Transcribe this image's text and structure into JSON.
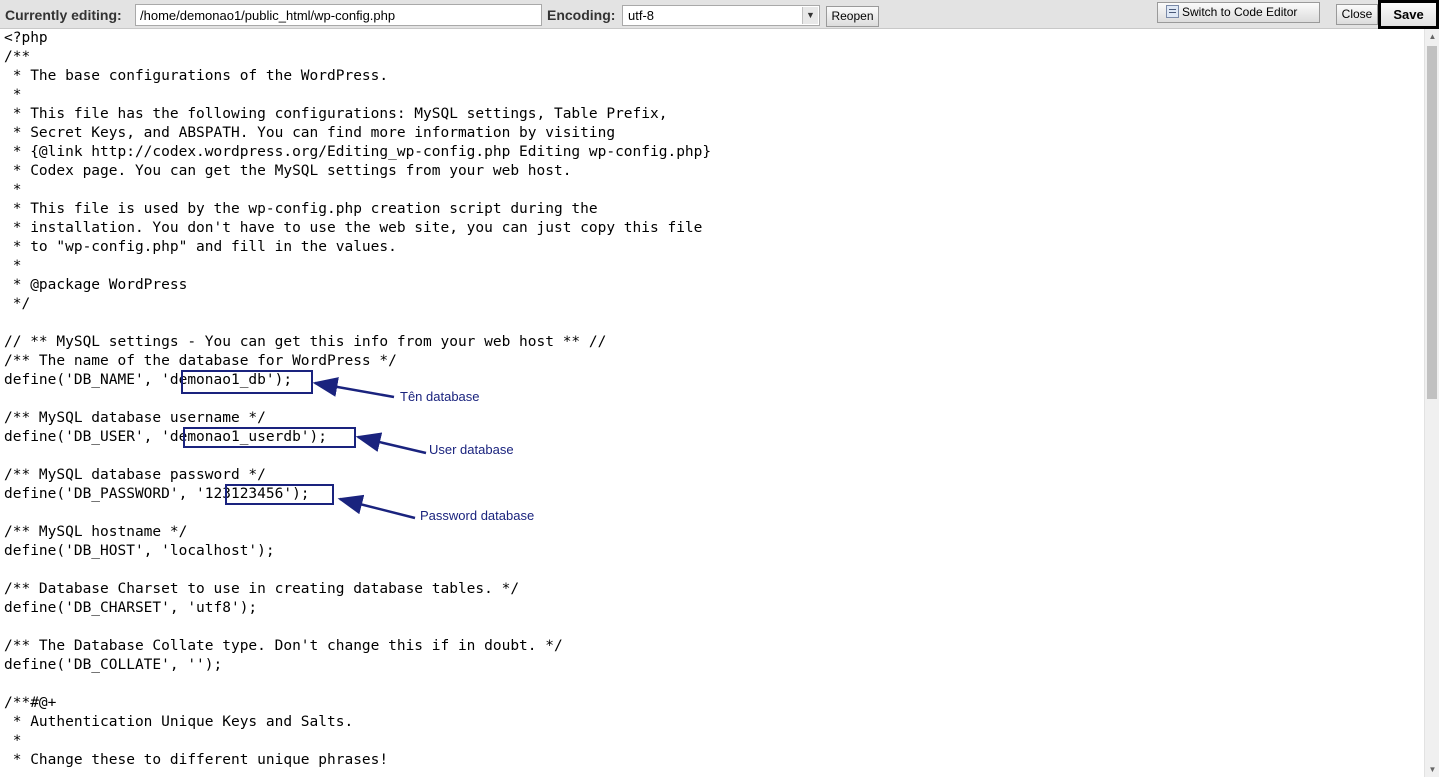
{
  "toolbar": {
    "currently_editing_label": "Currently editing:",
    "file_path": "/home/demonao1/public_html/wp-config.php",
    "encoding_label": "Encoding:",
    "encoding_value": "utf-8",
    "reopen_label": "Reopen",
    "code_editor_label": "Switch to Code Editor",
    "close_label": "Close",
    "save_label": "Save"
  },
  "editor": {
    "lines": [
      "<?php",
      "/**",
      " * The base configurations of the WordPress.",
      " *",
      " * This file has the following configurations: MySQL settings, Table Prefix,",
      " * Secret Keys, and ABSPATH. You can find more information by visiting",
      " * {@link http://codex.wordpress.org/Editing_wp-config.php Editing wp-config.php}",
      " * Codex page. You can get the MySQL settings from your web host.",
      " *",
      " * This file is used by the wp-config.php creation script during the",
      " * installation. You don't have to use the web site, you can just copy this file",
      " * to \"wp-config.php\" and fill in the values.",
      " *",
      " * @package WordPress",
      " */",
      "",
      "// ** MySQL settings - You can get this info from your web host ** //",
      "/** The name of the database for WordPress */",
      "define('DB_NAME', 'demonao1_db');",
      "",
      "/** MySQL database username */",
      "define('DB_USER', 'demonao1_userdb');",
      "",
      "/** MySQL database password */",
      "define('DB_PASSWORD', '123123456');",
      "",
      "/** MySQL hostname */",
      "define('DB_HOST', 'localhost');",
      "",
      "/** Database Charset to use in creating database tables. */",
      "define('DB_CHARSET', 'utf8');",
      "",
      "/** The Database Collate type. Don't change this if in doubt. */",
      "define('DB_COLLATE', '');",
      "",
      "/**#@+",
      " * Authentication Unique Keys and Salts.",
      " *",
      " * Change these to different unique phrases!"
    ]
  },
  "annotations": {
    "db_name": "Tên database",
    "db_user": "User database",
    "db_password": "Password database",
    "color": "#1a237e"
  }
}
